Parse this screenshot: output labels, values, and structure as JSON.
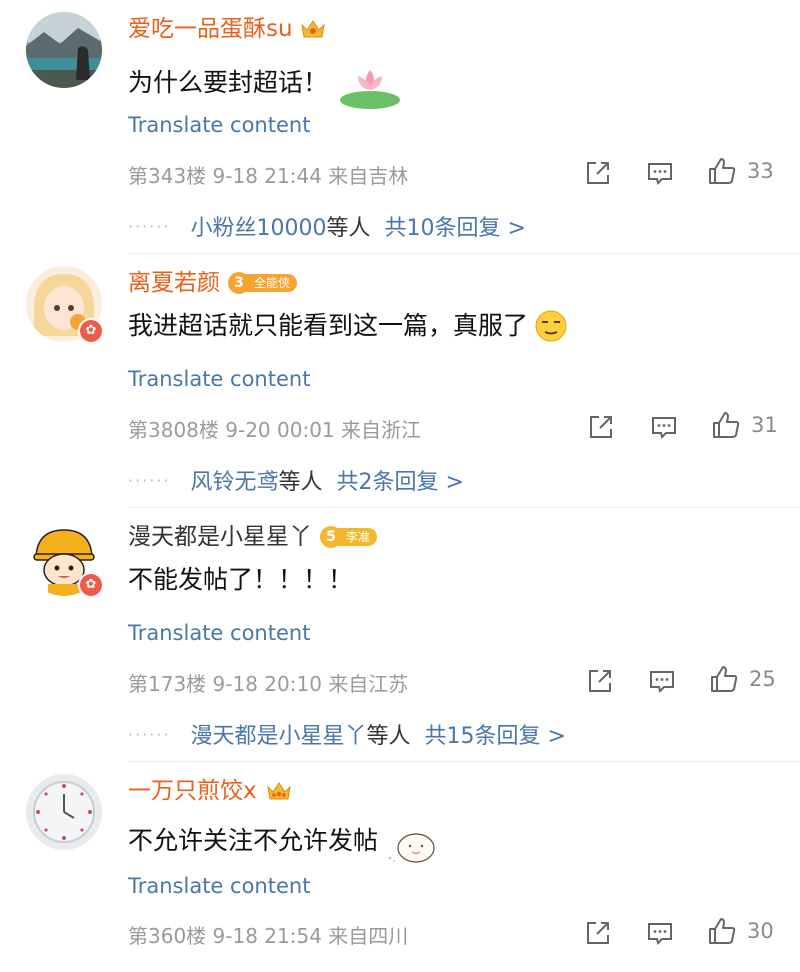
{
  "ui": {
    "translate_label": "Translate content"
  },
  "comments": [
    {
      "username": "爱吃一品蛋酥su",
      "text": "为什么要封超话！",
      "floor": "第343楼",
      "time": "9-18 21:44",
      "location": "来自吉林",
      "likes": "33",
      "reply_preview": {
        "user": "小粉丝10000",
        "suffix": "等人",
        "count_text": "共10条回复 >"
      }
    },
    {
      "username": "离夏若颜",
      "level": "3",
      "level_title": "全能侠",
      "text": "我进超话就只能看到这一篇，真服了",
      "floor": "第3808楼",
      "time": "9-20 00:01",
      "location": "来自浙江",
      "likes": "31",
      "reply_preview": {
        "user": "风铃无鸢",
        "suffix": "等人",
        "count_text": "共2条回复 >"
      }
    },
    {
      "username": "漫天都是小星星丫",
      "level": "5",
      "level_title": "李准",
      "text": "不能发帖了！！！！",
      "floor": "第173楼",
      "time": "9-18 20:10",
      "location": "来自江苏",
      "likes": "25",
      "reply_preview": {
        "user": "漫天都是小星星丫",
        "suffix": "等人",
        "count_text": "共15条回复 >"
      }
    },
    {
      "username": "一万只煎饺x",
      "text": "不允许关注不允许发帖",
      "floor": "第360楼",
      "time": "9-18 21:54",
      "location": "来自四川",
      "likes": "30"
    }
  ],
  "colors": {
    "username_vip": "#e8601b",
    "link_blue": "#4a76a8",
    "meta_grey": "#9a9a9a",
    "badge_orange": "#f7a32f",
    "badge_gold": "#f2b92c"
  },
  "icons": [
    "crown-icon",
    "share-icon",
    "comment-icon",
    "like-icon",
    "verified-badge-icon"
  ]
}
